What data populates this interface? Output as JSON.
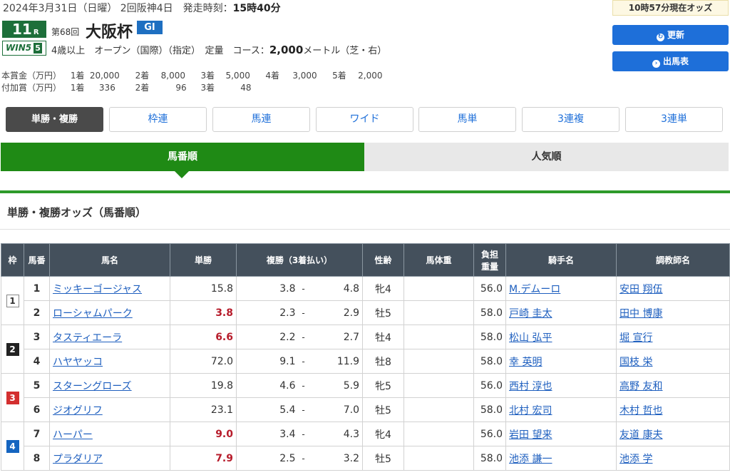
{
  "race": {
    "date_text": "2024年3月31日（日曜） 2回阪神4日　発走時刻：",
    "post_time": "15時40分",
    "race_number": "11",
    "race_number_suffix": "R",
    "wins_label": "WIN5",
    "wins_num": "5",
    "kai": "第68回",
    "name": "大阪杯",
    "grade": "GI",
    "conditions_prefix": "4歳以上　オープン（国際）（指定）　定量　コース：",
    "distance": "2,000",
    "conditions_suffix": "メートル（芝・右）"
  },
  "prize": {
    "main_label": "本賞金（万円）",
    "main": [
      {
        "place": "1着",
        "amount": "20,000"
      },
      {
        "place": "2着",
        "amount": "8,000"
      },
      {
        "place": "3着",
        "amount": "5,000"
      },
      {
        "place": "4着",
        "amount": "3,000"
      },
      {
        "place": "5着",
        "amount": "2,000"
      }
    ],
    "add_label": "付加賞（万円）",
    "add": [
      {
        "place": "1着",
        "amount": "336"
      },
      {
        "place": "2着",
        "amount": "96"
      },
      {
        "place": "3着",
        "amount": "48"
      }
    ]
  },
  "side": {
    "as_of": "10時57分現在オッズ",
    "refresh_label": "更新",
    "entries_label": "出馬表"
  },
  "bet_tabs": [
    "単勝・複勝",
    "枠連",
    "馬連",
    "ワイド",
    "馬単",
    "3連複",
    "3連単"
  ],
  "sort_tabs": {
    "left": "馬番順",
    "right": "人気順"
  },
  "section_title": "単勝・複勝オッズ（馬番順）",
  "table": {
    "headers": {
      "waku": "枠",
      "umaban": "馬番",
      "horse": "馬名",
      "win": "単勝",
      "place": "複勝（3着払い）",
      "sexage": "性齢",
      "weight": "馬体重",
      "burden_1": "負担",
      "burden_2": "重量",
      "jockey": "騎手名",
      "trainer": "調教師名"
    },
    "rows": [
      {
        "waku": "1",
        "num": "1",
        "horse": "ミッキーゴージャス",
        "win": "15.8",
        "plc_lo": "3.8",
        "plc_hi": "4.8",
        "sexage": "牝4",
        "weight": "",
        "burden": "56.0",
        "jockey": "M.デムーロ",
        "trainer": "安田 翔伍"
      },
      {
        "waku": "",
        "num": "2",
        "horse": "ローシャムパーク",
        "win": "3.8",
        "plc_lo": "2.3",
        "plc_hi": "2.9",
        "sexage": "牡5",
        "weight": "",
        "burden": "58.0",
        "jockey": "戸崎 圭太",
        "trainer": "田中 博康"
      },
      {
        "waku": "2",
        "num": "3",
        "horse": "タスティエーラ",
        "win": "6.6",
        "plc_lo": "2.2",
        "plc_hi": "2.7",
        "sexage": "牡4",
        "weight": "",
        "burden": "58.0",
        "jockey": "松山 弘平",
        "trainer": "堀 宣行"
      },
      {
        "waku": "",
        "num": "4",
        "horse": "ハヤヤッコ",
        "win": "72.0",
        "plc_lo": "9.1",
        "plc_hi": "11.9",
        "sexage": "牡8",
        "weight": "",
        "burden": "58.0",
        "jockey": "幸 英明",
        "trainer": "国枝 栄"
      },
      {
        "waku": "3",
        "num": "5",
        "horse": "スターングローズ",
        "win": "19.8",
        "plc_lo": "4.6",
        "plc_hi": "5.9",
        "sexage": "牝5",
        "weight": "",
        "burden": "56.0",
        "jockey": "西村 淳也",
        "trainer": "高野 友和"
      },
      {
        "waku": "",
        "num": "6",
        "horse": "ジオグリフ",
        "win": "23.1",
        "plc_lo": "5.4",
        "plc_hi": "7.0",
        "sexage": "牡5",
        "weight": "",
        "burden": "58.0",
        "jockey": "北村 宏司",
        "trainer": "木村 哲也"
      },
      {
        "waku": "4",
        "num": "7",
        "horse": "ハーパー",
        "win": "9.0",
        "plc_lo": "3.4",
        "plc_hi": "4.3",
        "sexage": "牝4",
        "weight": "",
        "burden": "56.0",
        "jockey": "岩田 望来",
        "trainer": "友道 康夫"
      },
      {
        "waku": "",
        "num": "8",
        "horse": "プラダリア",
        "win": "7.9",
        "plc_lo": "2.5",
        "plc_hi": "3.2",
        "sexage": "牡5",
        "weight": "",
        "burden": "58.0",
        "jockey": "池添 謙一",
        "trainer": "池添 学"
      }
    ]
  },
  "colors": {
    "win_highlight": "#b71c2b",
    "green": "#1f8a15",
    "blue": "#1e6fd9",
    "header": "#44505c"
  }
}
